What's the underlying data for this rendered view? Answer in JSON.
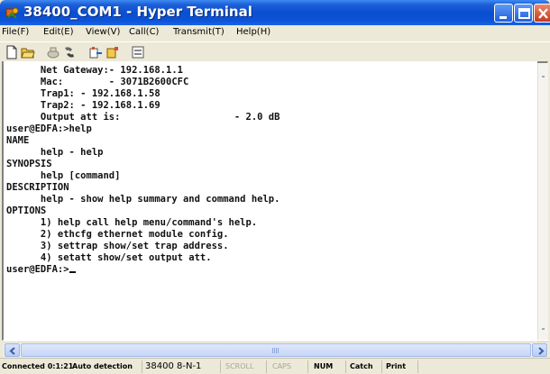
{
  "window": {
    "title": "38400_COM1 - Hyper Terminal",
    "controls": [
      "minimize",
      "maximize",
      "close"
    ]
  },
  "menu": {
    "items": [
      {
        "label": "File(F)"
      },
      {
        "label": "Edit(E)"
      },
      {
        "label": "View(V)"
      },
      {
        "label": "Call(C)"
      },
      {
        "label": "Transmit(T)"
      },
      {
        "label": "Help(H)"
      }
    ]
  },
  "toolbar": {
    "buttons": [
      "new-icon",
      "open-icon",
      "disconnect-icon",
      "dial-icon",
      "send-icon",
      "receive-icon",
      "properties-icon"
    ]
  },
  "terminal": {
    "lines": [
      "      Net Gateway:- 192.168.1.1",
      "      Mac:        - 3071B2600CFC",
      "      Trap1: - 192.168.1.58",
      "      Trap2: - 192.168.1.69",
      "      Output att is:                    - 2.0 dB",
      "user@EDFA:>help",
      "NAME",
      "      help - help",
      "SYNOPSIS",
      "      help [command]",
      "DESCRIPTION",
      "      help - show help summary and command help.",
      "OPTIONS",
      "      1) help call help menu/command's help.",
      "      2) ethcfg ethernet module config.",
      "      3) settrap show/set trap address.",
      "      4) setatt show/set output att.",
      "user@EDFA:>"
    ]
  },
  "status": {
    "connected": "Connected 0:1:21",
    "detection": "Auto detection",
    "port": "38400 8-N-1",
    "scroll": "SCROLL",
    "caps": "CAPS",
    "num": "NUM",
    "catch": "Catch",
    "print": "Print"
  },
  "colors": {
    "titlebar": "#0a4fd0",
    "close_button": "#c6391b",
    "terminal_bg": "#ffffff",
    "terminal_text": "#111111"
  }
}
